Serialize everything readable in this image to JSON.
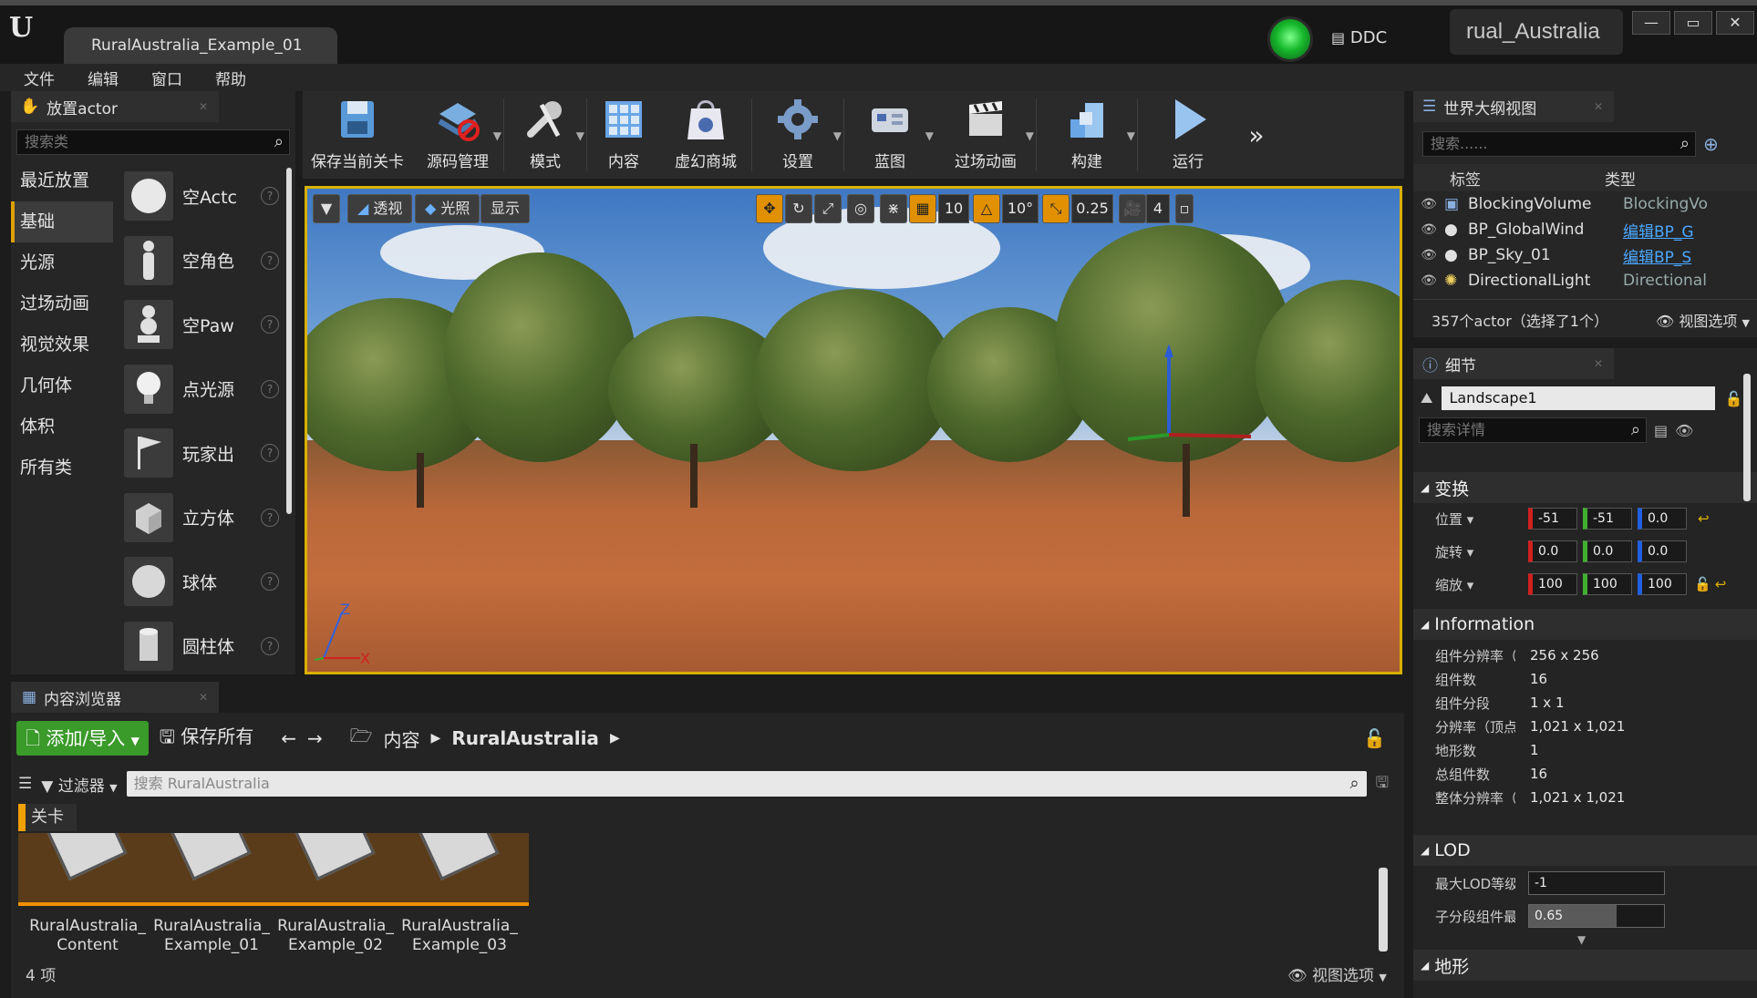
{
  "window": {
    "doc_tab": "RuralAustralia_Example_01",
    "ddc_label": "DDC",
    "project_name": "rual_Australia",
    "buttons": [
      "—",
      "▭",
      "✕"
    ]
  },
  "menu": [
    "文件",
    "编辑",
    "窗口",
    "帮助"
  ],
  "place_actor": {
    "tab_label": "放置actor",
    "search_placeholder": "搜索类",
    "categories": [
      "最近放置",
      "基础",
      "光源",
      "过场动画",
      "视觉效果",
      "几何体",
      "体积",
      "所有类"
    ],
    "active_category": "基础",
    "actors": [
      "空Actc",
      "空角色",
      "空Paw",
      "点光源",
      "玩家出",
      "立方体",
      "球体",
      "圆柱体"
    ]
  },
  "toolbar": {
    "items": [
      "保存当前关卡",
      "源码管理",
      "模式",
      "内容",
      "虚幻商城",
      "设置",
      "蓝图",
      "过场动画",
      "构建",
      "运行"
    ]
  },
  "viewport": {
    "perspective_label": "透视",
    "lighting_label": "光照",
    "show_label": "显示",
    "grid_snap": "10",
    "rotation_snap": "10°",
    "scale_snap": "0.25",
    "camera_speed": "4",
    "axis_x": "X",
    "axis_z": "Z"
  },
  "content_browser": {
    "tab_label": "内容浏览器",
    "add_import": "添加/导入",
    "save_all": "保存所有",
    "path": [
      "内容",
      "RuralAustralia"
    ],
    "filter_label": "过滤器",
    "search_placeholder": "搜索 RuralAustralia",
    "folder_tag": "关卡",
    "assets": [
      {
        "line1": "RuralAustralia_",
        "line2": "Content"
      },
      {
        "line1": "RuralAustralia_",
        "line2": "Example_01"
      },
      {
        "line1": "RuralAustralia_",
        "line2": "Example_02"
      },
      {
        "line1": "RuralAustralia_",
        "line2": "Example_03"
      }
    ],
    "count": "4 项",
    "view_options": "视图选项"
  },
  "outliner": {
    "tab_label": "世界大纲视图",
    "search_placeholder": "搜索......",
    "col_label": "标签",
    "col_type": "类型",
    "rows": [
      {
        "label": "BlockingVolume",
        "type": "BlockingVo",
        "link": false
      },
      {
        "label": "BP_GlobalWind",
        "type": "编辑BP_G",
        "link": true
      },
      {
        "label": "BP_Sky_01",
        "type": "编辑BP_S",
        "link": true
      },
      {
        "label": "DirectionalLight",
        "type": "Directional",
        "link": false
      }
    ],
    "summary": "357个actor（选择了1个）",
    "view_options": "视图选项"
  },
  "details": {
    "tab_label": "细节",
    "actor_name": "Landscape1",
    "search_placeholder": "搜索详情",
    "transform_title": "变换",
    "location_label": "位置",
    "rotation_label": "旋转",
    "scale_label": "缩放",
    "location": [
      "-51",
      "-51",
      "0.0"
    ],
    "rotation": [
      "0.0",
      "0.0",
      "0.0"
    ],
    "scale": [
      "100",
      "100",
      "100"
    ],
    "information_title": "Information",
    "info": [
      {
        "label": "组件分辨率（",
        "value": "256 x 256"
      },
      {
        "label": "组件数",
        "value": "16"
      },
      {
        "label": "组件分段",
        "value": "1 x 1"
      },
      {
        "label": "分辨率（顶点",
        "value": "1,021 x 1,021"
      },
      {
        "label": "地形数",
        "value": "1"
      },
      {
        "label": "总组件数",
        "value": "16"
      },
      {
        "label": "整体分辨率（",
        "value": "1,021 x 1,021"
      }
    ],
    "lod_title": "LOD",
    "lod_max_label": "最大LOD等级",
    "lod_max_value": "-1",
    "lod_sub_label": "子分段组件最",
    "lod_sub_value": "0.65",
    "terrain_title": "地形"
  }
}
